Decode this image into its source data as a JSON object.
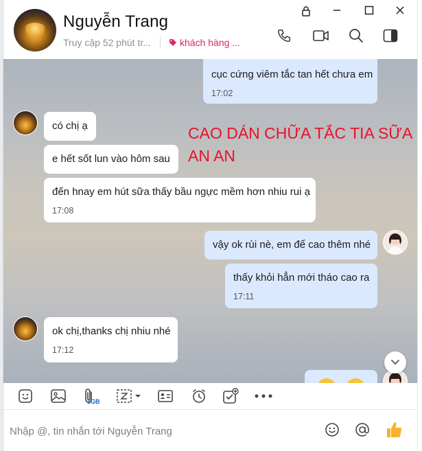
{
  "contact": {
    "name": "Nguyễn Trang",
    "status": "Truy cập 52 phút tr...",
    "tag": "khách hàng ..."
  },
  "overlay": {
    "line1": "CAO DÁN CHỮA TẮC TIA SỮA",
    "line2": "AN AN"
  },
  "messages": [
    {
      "from": "me",
      "text": "cục cứng viêm tắc tan hết chưa em",
      "time": "17:02"
    },
    {
      "from": "them",
      "text": "có chị ạ",
      "time": ""
    },
    {
      "from": "them",
      "text": "e hết sốt lun vào hôm sau",
      "time": ""
    },
    {
      "from": "them",
      "text": "đến hnay em hút sữa thấy bầu ngực mềm hơn nhiu rui ạ",
      "time": "17:08"
    },
    {
      "from": "me",
      "text": "vậy ok rùi nè, em để cao thêm nhé",
      "time": ""
    },
    {
      "from": "me",
      "text": "thấy khỏi hẳn mới tháo cao ra",
      "time": "17:11"
    },
    {
      "from": "them",
      "text": "ok chị,thanks chị nhiu nhé",
      "time": "17:12"
    }
  ],
  "toolbar": {
    "file_size_badge": "1GB",
    "icons": [
      "sticker-icon",
      "image-icon",
      "attachment-icon",
      "screenshot-icon",
      "contact-card-icon",
      "reminder-icon",
      "task-icon",
      "more-icon"
    ]
  },
  "input": {
    "placeholder": "Nhập @, tin nhắn tới Nguyễn Trang"
  },
  "colors": {
    "my_bubble": "#dbe9ff",
    "their_bubble": "#ffffff",
    "tag": "#e0245e",
    "overlay_text": "#e8122a",
    "like": "#f7b32b"
  }
}
